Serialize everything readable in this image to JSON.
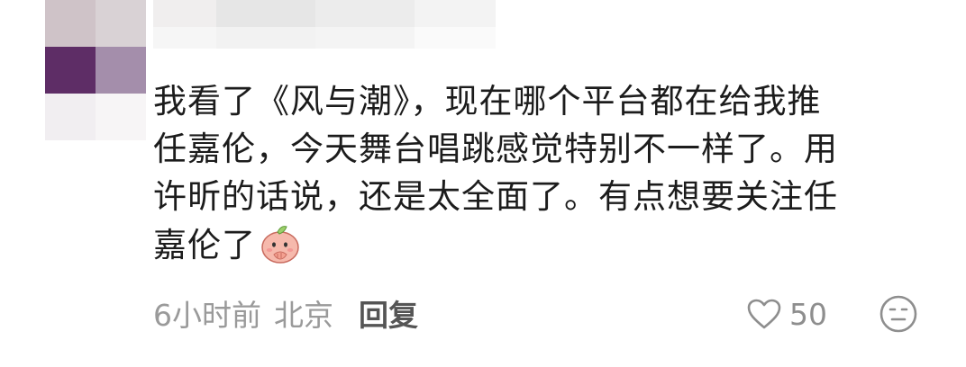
{
  "comment": {
    "lines": [
      "我看了《风与潮》，现在哪个平台都在给我推",
      "任嘉伦，今天舞台唱跳感觉特别不一样了。用",
      "许昕的话说，还是太全面了。有点想要关注任",
      "嘉伦了"
    ],
    "trailing_emoji": "peach-covering-mouth-emoji"
  },
  "meta": {
    "time": "6小时前",
    "location": "北京",
    "reply_label": "回复"
  },
  "actions": {
    "like_icon": "heart-outline-icon",
    "like_count": "50",
    "emoji_icon": "smiley-face-icon"
  },
  "colors": {
    "text": "#1c1c1c",
    "meta": "#9a9a9a",
    "reply": "#555555",
    "icon": "#8e8e8e",
    "avatar_purple": "#5e2d66",
    "peach": "#f6b9ac"
  }
}
